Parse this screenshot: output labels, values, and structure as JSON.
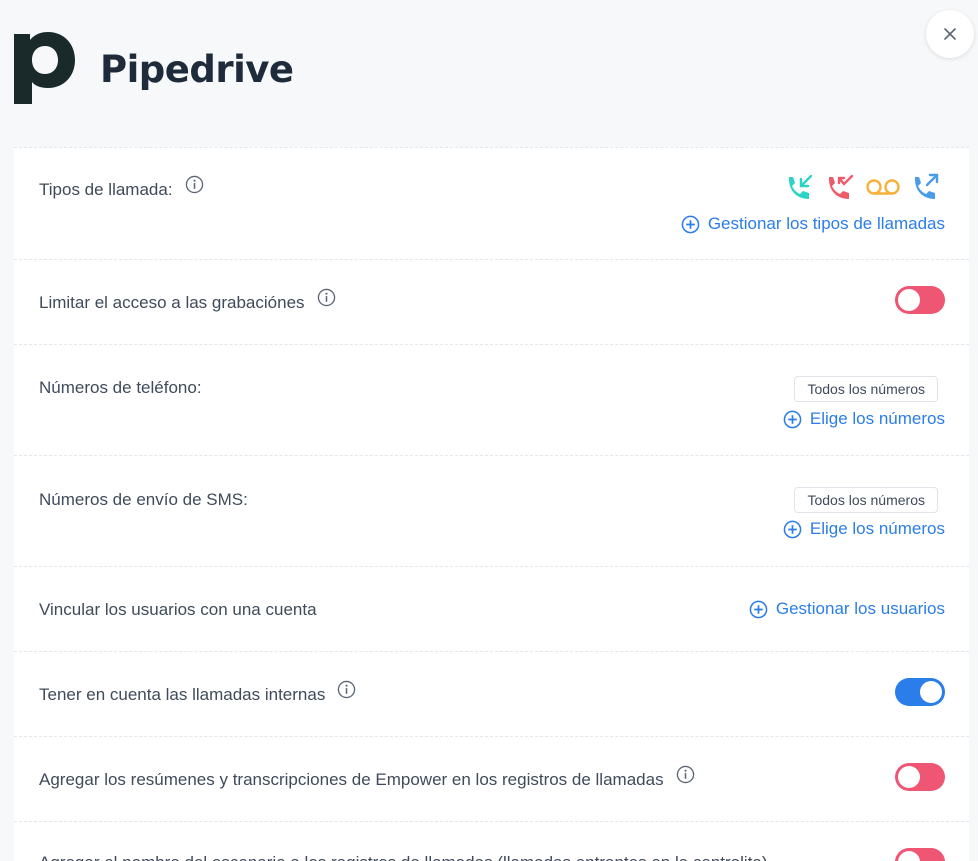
{
  "brand": {
    "name": "Pipedrive",
    "mark_color": "#1a2a2a"
  },
  "close": {
    "label": "×"
  },
  "rows": [
    {
      "label": "Tipos de llamada:",
      "has_info": true,
      "call_types": [
        "incoming-call-icon",
        "missed-call-icon",
        "voicemail-icon",
        "outgoing-call-icon"
      ],
      "call_type_colors": [
        "#2bd4c4",
        "#ef5a68",
        "#f6b13a",
        "#4a9be8"
      ],
      "link": "Gestionar los tipos de llamadas"
    },
    {
      "label": "Limitar el acceso a las grabaciónes",
      "has_info": true,
      "toggle": "off"
    },
    {
      "label": "Números de teléfono:",
      "chip": "Todos los números",
      "link": "Elige los números"
    },
    {
      "label": "Números de envío de SMS:",
      "chip": "Todos los números",
      "link": "Elige los números"
    },
    {
      "label": "Vincular los usuarios con una cuenta",
      "link": "Gestionar los usuarios"
    },
    {
      "label": "Tener en cuenta las llamadas internas",
      "has_info": true,
      "toggle": "on"
    },
    {
      "label": "Agregar los resúmenes y transcripciones de Empower en los registros de llamadas",
      "has_info": true,
      "toggle": "off"
    },
    {
      "label": "Agregar el nombre del escenario a los registros de llamadas (llamadas entrantes en la centralita)",
      "toggle": "off"
    }
  ],
  "colors": {
    "link": "#2b7de9",
    "toggle_off": "#ef5673",
    "toggle_on": "#2b7de9"
  }
}
